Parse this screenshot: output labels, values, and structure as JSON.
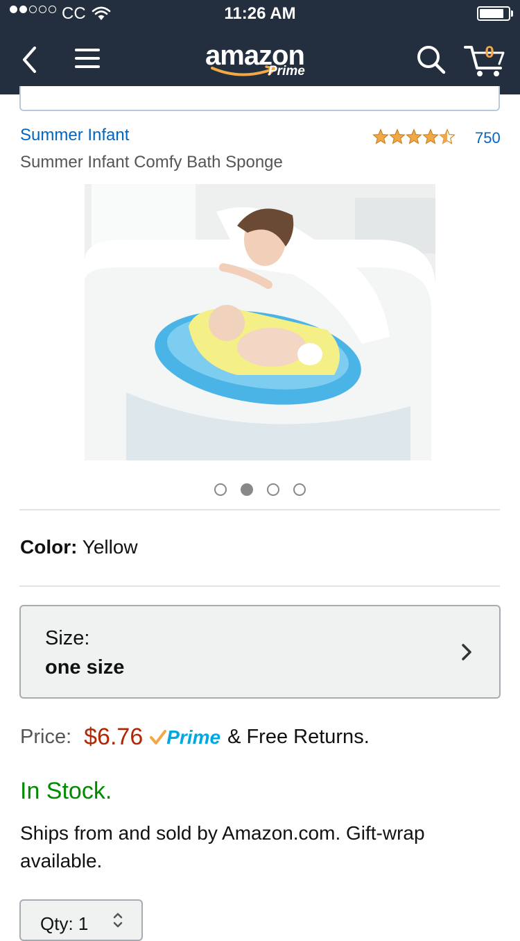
{
  "status_bar": {
    "carrier": "CC",
    "time": "11:26 AM"
  },
  "nav": {
    "logo_word": "amazon",
    "logo_sub": "Prime",
    "cart_count": "0",
    "icons": [
      "back-icon",
      "menu-icon",
      "search-icon",
      "cart-icon"
    ]
  },
  "product": {
    "brand": "Summer Infant",
    "rating": 4.5,
    "rating_count": "750",
    "title": "Summer Infant Comfy Bath Sponge",
    "image_count": 4,
    "active_image": 2
  },
  "color": {
    "label": "Color:",
    "value": "Yellow"
  },
  "size": {
    "label": "Size:",
    "value": "one size"
  },
  "price": {
    "label": "Price:",
    "value": "$6.76",
    "prime_label": "Prime",
    "returns_text": "& Free Returns."
  },
  "stock": {
    "status": "In Stock.",
    "ships_text": "Ships from and sold by Amazon.com. Gift-wrap available."
  },
  "quantity": {
    "label": "Qty:",
    "value": "1"
  },
  "colors": {
    "header_bg": "#232f3e",
    "link": "#0066c0",
    "price": "#b12704",
    "in_stock": "#008a00",
    "prime": "#00a8e1",
    "star": "#f3a847"
  }
}
